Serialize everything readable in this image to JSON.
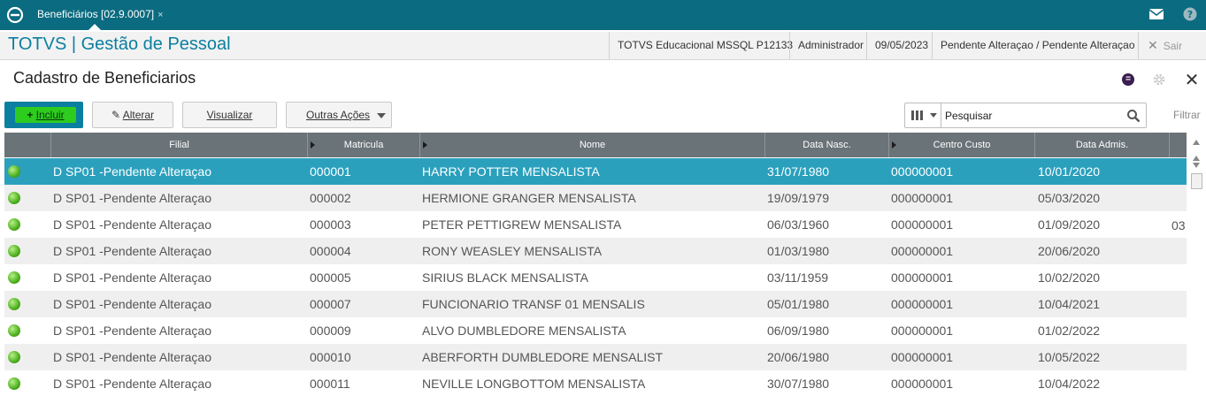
{
  "topbar": {
    "tab_label": "Beneficiários [02.9.0007]",
    "tab_close": "×"
  },
  "product": {
    "title": "TOTVS | Gestão de Pessoal",
    "environment": "TOTVS Educacional MSSQL P12133",
    "user": "Administrador",
    "date": "09/05/2023",
    "filial": "Pendente Alteraçao / Pendente Alteraçao",
    "exit_label": "Sair"
  },
  "page": {
    "title": "Cadastro de Beneficiarios",
    "circle_icon_glyph": "="
  },
  "toolbar": {
    "incluir": "Incluir",
    "alterar": "Alterar",
    "visualizar": "Visualizar",
    "outras_acoes": "Outras Ações"
  },
  "search": {
    "placeholder": "Pesquisar",
    "filter_label": "Filtrar"
  },
  "grid": {
    "columns": [
      "Filial",
      "Matricula",
      "Nome",
      "Data Nasc.",
      "Centro Custo",
      "Data Admis."
    ],
    "rows": [
      {
        "filial": "D SP01  -Pendente Alteraçao",
        "matricula": "000001",
        "nome": "HARRY POTTER MENSALISTA",
        "nasc": "31/07/1980",
        "cc": "000000001",
        "admis": "10/01/2020"
      },
      {
        "filial": "D SP01  -Pendente Alteraçao",
        "matricula": "000002",
        "nome": "HERMIONE GRANGER MENSALISTA",
        "nasc": "19/09/1979",
        "cc": "000000001",
        "admis": "05/03/2020"
      },
      {
        "filial": "D SP01  -Pendente Alteraçao",
        "matricula": "000003",
        "nome": "PETER PETTIGREW MENSALISTA",
        "nasc": "06/03/1960",
        "cc": "000000001",
        "admis": "01/09/2020"
      },
      {
        "filial": "D SP01  -Pendente Alteraçao",
        "matricula": "000004",
        "nome": "RONY WEASLEY MENSALISTA",
        "nasc": "01/03/1980",
        "cc": "000000001",
        "admis": "20/06/2020"
      },
      {
        "filial": "D SP01  -Pendente Alteraçao",
        "matricula": "000005",
        "nome": "SIRIUS BLACK MENSALISTA",
        "nasc": "03/11/1959",
        "cc": "000000001",
        "admis": "10/02/2020"
      },
      {
        "filial": "D SP01  -Pendente Alteraçao",
        "matricula": "000007",
        "nome": "FUNCIONARIO TRANSF 01 MENSALIS",
        "nasc": "05/01/1980",
        "cc": "000000001",
        "admis": "10/04/2021"
      },
      {
        "filial": "D SP01  -Pendente Alteraçao",
        "matricula": "000009",
        "nome": "ALVO DUMBLEDORE MENSALISTA",
        "nasc": "06/09/1980",
        "cc": "000000001",
        "admis": "01/02/2022"
      },
      {
        "filial": "D SP01  -Pendente Alteraçao",
        "matricula": "000010",
        "nome": "ABERFORTH DUMBLEDORE MENSALIST",
        "nasc": "20/06/1980",
        "cc": "000000001",
        "admis": "10/05/2022"
      },
      {
        "filial": "D SP01  -Pendente Alteraçao",
        "matricula": "000011",
        "nome": "NEVILLE LONGBOTTOM MENSALISTA",
        "nasc": "30/07/1980",
        "cc": "000000001",
        "admis": "10/04/2022"
      }
    ],
    "stray_text": "03"
  },
  "colors": {
    "topbar": "#0b6b80",
    "accent": "#0b7fa0",
    "selected_row": "#2aa0bd",
    "incluir_green": "#2ecc1f",
    "header_bg": "#6a7378"
  },
  "icons": {
    "logo": "totvs-logo-icon",
    "mail": "mail-icon",
    "help": "help-icon",
    "gear": "gear-icon",
    "close": "close-icon",
    "search": "search-icon",
    "columns": "columns-icon",
    "status": "status-green-icon"
  }
}
